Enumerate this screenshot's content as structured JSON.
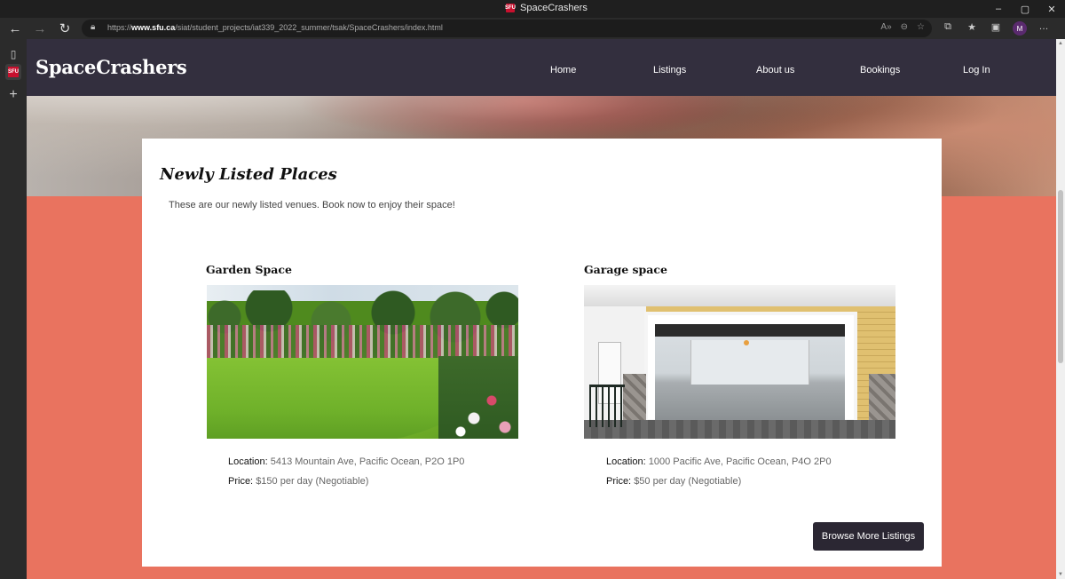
{
  "browser": {
    "tab_title": "SpaceCrashers",
    "favicon_text": "SFU",
    "url_prefix": "https://",
    "url_domain": "www.sfu.ca",
    "url_path": "/siat/student_projects/iat339_2022_summer/tsak/SpaceCrashers/index.html",
    "window_controls": [
      "–",
      "▢",
      "✕"
    ]
  },
  "site": {
    "logo": "SpaceCrashers",
    "nav": [
      "Home",
      "Listings",
      "About us",
      "Bookings",
      "Log In"
    ]
  },
  "section": {
    "title": "Newly Listed Places",
    "subtitle": "These are our newly listed venues. Book now to enjoy their space!"
  },
  "listings": [
    {
      "name": "Garden Space",
      "location_label": "Location:",
      "location": "5413 Mountain Ave, Pacific Ocean, P2O 1P0",
      "price_label": "Price:",
      "price": "$150 per day (Negotiable)"
    },
    {
      "name": "Garage space",
      "location_label": "Location:",
      "location": "1000 Pacific Ave, Pacific Ocean, P4O 2P0",
      "price_label": "Price:",
      "price": "$50 per day (Negotiable)"
    }
  ],
  "actions": {
    "browse": "Browse More Listings"
  },
  "colors": {
    "header_bg": "#332f3e",
    "section_bg": "#e9735f",
    "button_bg": "#2b2733"
  }
}
